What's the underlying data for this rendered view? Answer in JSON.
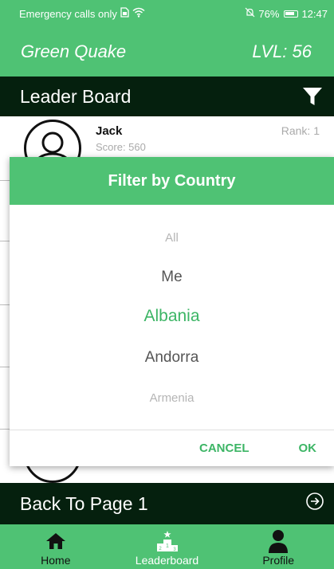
{
  "status_bar": {
    "left_text": "Emergency calls only",
    "battery_text": "76%",
    "time": "12:47"
  },
  "app_header": {
    "title": "Green Quake",
    "level": "LVL: 56"
  },
  "leaderboard_header": {
    "title": "Leader Board",
    "filter_icon": "filter-icon"
  },
  "leaderboard": {
    "rows": [
      {
        "name": "Jack",
        "score": "Score: 560",
        "rank": "Rank: 1"
      }
    ]
  },
  "filter_dialog": {
    "title": "Filter by Country",
    "options": [
      "All",
      "Me",
      "Albania",
      "Andorra",
      "Armenia"
    ],
    "selected": "Albania",
    "cancel_label": "CANCEL",
    "ok_label": "OK"
  },
  "back_bar": {
    "label": "Back To Page 1",
    "icon": "arrow-circle-right-icon"
  },
  "tab_bar": {
    "tabs": [
      {
        "label": "Home",
        "icon": "home-icon"
      },
      {
        "label": "Leaderboard",
        "icon": "podium-icon"
      },
      {
        "label": "Profile",
        "icon": "person-icon"
      }
    ],
    "active": "Leaderboard"
  },
  "colors": {
    "primary_green": "#4fc274",
    "dark_bar": "#05200e",
    "accent_text": "#3cb565"
  }
}
